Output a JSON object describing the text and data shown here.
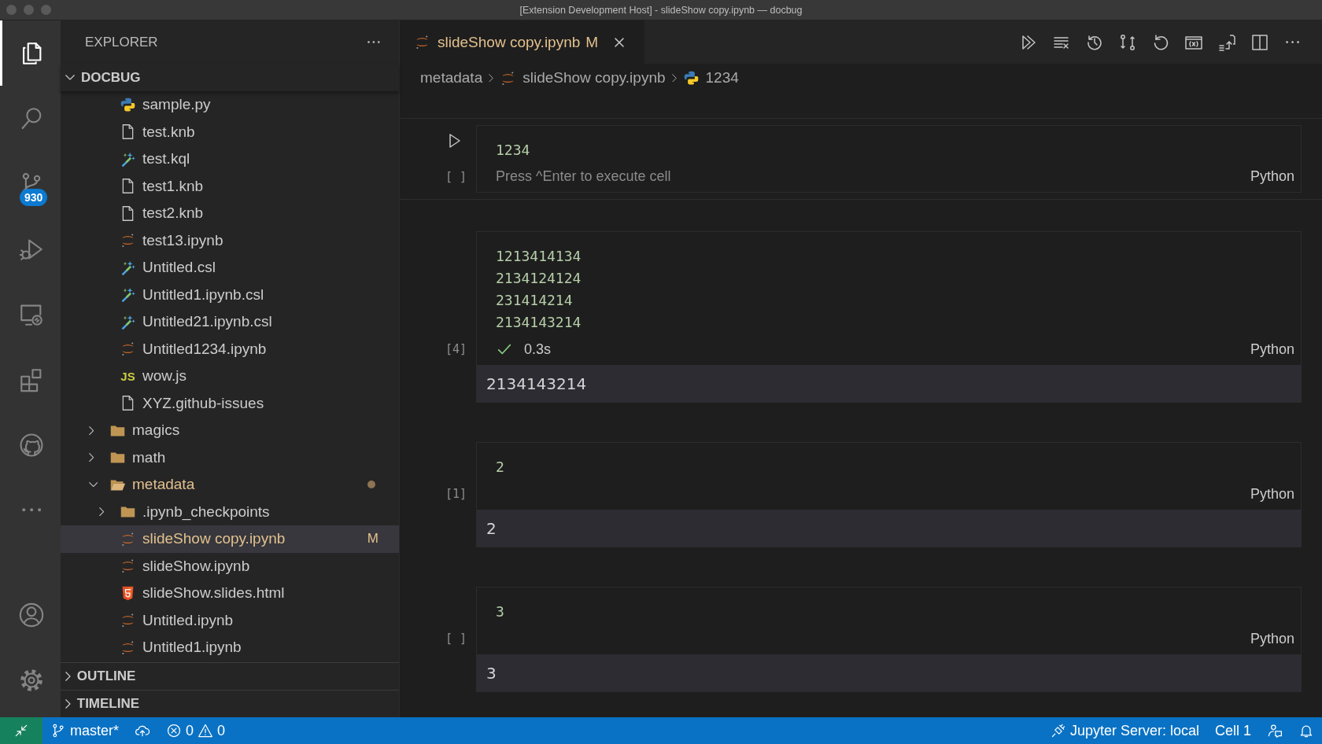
{
  "window": {
    "title": "[Extension Development Host] - slideShow copy.ipynb — docbug"
  },
  "activity_bar": {
    "items": [
      {
        "kind": "explorer",
        "selected": true
      },
      {
        "kind": "search",
        "selected": false
      },
      {
        "kind": "source-control",
        "selected": false,
        "badge": "930"
      },
      {
        "kind": "run-debug",
        "selected": false
      },
      {
        "kind": "remote",
        "selected": false
      },
      {
        "kind": "extensions",
        "selected": false
      },
      {
        "kind": "github",
        "selected": false
      },
      {
        "kind": "more",
        "selected": false
      }
    ],
    "bottom": [
      {
        "kind": "account"
      },
      {
        "kind": "settings"
      }
    ]
  },
  "sidebar": {
    "title": "EXPLORER",
    "root": {
      "label": "DOCBUG",
      "expanded": true
    },
    "tree": [
      {
        "kind": "offscreen-folder",
        "children": [
          {
            "kind": "python-file",
            "name": "sample.py",
            "selected": false,
            "modified": false
          },
          {
            "kind": "plain-file",
            "name": "test.knb",
            "selected": false,
            "modified": false
          },
          {
            "kind": "kql-file",
            "name": "test.kql",
            "selected": false,
            "modified": false
          },
          {
            "kind": "plain-file",
            "name": "test1.knb",
            "selected": false,
            "modified": false
          },
          {
            "kind": "plain-file",
            "name": "test2.knb",
            "selected": false,
            "modified": false
          },
          {
            "kind": "notebook-file",
            "name": "test13.ipynb",
            "selected": false,
            "modified": false
          },
          {
            "kind": "kql-file",
            "name": "Untitled.csl",
            "selected": false,
            "modified": false
          },
          {
            "kind": "kql-file",
            "name": "Untitled1.ipynb.csl",
            "selected": false,
            "modified": false
          },
          {
            "kind": "kql-file",
            "name": "Untitled21.ipynb.csl",
            "selected": false,
            "modified": false
          },
          {
            "kind": "notebook-file",
            "name": "Untitled1234.ipynb",
            "selected": false,
            "modified": false
          },
          {
            "kind": "js-file",
            "icon_label": "JS",
            "name": "wow.js",
            "selected": false,
            "modified": false
          },
          {
            "kind": "plain-file",
            "name": "XYZ.github-issues",
            "selected": false,
            "modified": false
          }
        ]
      },
      {
        "kind": "folder",
        "name": "magics",
        "expanded": false,
        "selected": false,
        "modified": false
      },
      {
        "kind": "folder",
        "name": "math",
        "expanded": false,
        "selected": false,
        "modified": false
      },
      {
        "kind": "folder",
        "name": "metadata",
        "expanded": true,
        "selected": false,
        "modified": true,
        "children": [
          {
            "kind": "folder",
            "name": ".ipynb_checkpoints",
            "expanded": false,
            "selected": false,
            "modified": false
          },
          {
            "kind": "notebook-file",
            "name": "slideShow copy.ipynb",
            "selected": true,
            "modified": true,
            "status": "M"
          },
          {
            "kind": "notebook-file",
            "name": "slideShow.ipynb",
            "selected": false,
            "modified": false
          },
          {
            "kind": "html-file",
            "name": "slideShow.slides.html",
            "selected": false,
            "modified": false
          },
          {
            "kind": "notebook-file",
            "name": "Untitled.ipynb",
            "selected": false,
            "modified": false
          },
          {
            "kind": "notebook-file",
            "name": "Untitled1.ipynb",
            "selected": false,
            "modified": false
          }
        ]
      }
    ],
    "sections": [
      {
        "label": "OUTLINE",
        "expanded": false
      },
      {
        "label": "TIMELINE",
        "expanded": false
      }
    ]
  },
  "editor": {
    "tabs": [
      {
        "kind": "notebook-file",
        "name": "slideShow copy.ipynb",
        "selected": true,
        "modified": true,
        "status": "M"
      }
    ],
    "toolbar": [
      {
        "kind": "run-all"
      },
      {
        "kind": "clear"
      },
      {
        "kind": "history"
      },
      {
        "kind": "diff"
      },
      {
        "kind": "restart"
      },
      {
        "kind": "variables"
      },
      {
        "kind": "export"
      },
      {
        "kind": "split"
      },
      {
        "kind": "more"
      }
    ],
    "breadcrumbs": [
      {
        "kind": "folder",
        "label": "metadata"
      },
      {
        "kind": "notebook-file",
        "label": "slideShow copy.ipynb"
      },
      {
        "kind": "python-file",
        "label": "1234"
      }
    ],
    "cells": [
      {
        "focused": true,
        "execution_label": "[ ]",
        "code": [
          "1234"
        ],
        "hint": "Press ^Enter to execute cell",
        "language": "Python"
      },
      {
        "focused": false,
        "execution_label": "[4]",
        "code": [
          "1213414134",
          "2134124124",
          "231414214",
          "2134143214"
        ],
        "status": {
          "success": true,
          "time": "0.3s"
        },
        "language": "Python",
        "output": "2134143214"
      },
      {
        "focused": false,
        "execution_label": "[1]",
        "code": [
          "2"
        ],
        "language": "Python",
        "output": "2"
      },
      {
        "focused": false,
        "execution_label": "[ ]",
        "code": [
          "3"
        ],
        "language": "Python",
        "output": "3"
      }
    ]
  },
  "status_bar": {
    "branch": "master*",
    "errors": "0",
    "warnings": "0",
    "kernel": "Jupyter Server: local",
    "cell": "Cell 1"
  }
}
